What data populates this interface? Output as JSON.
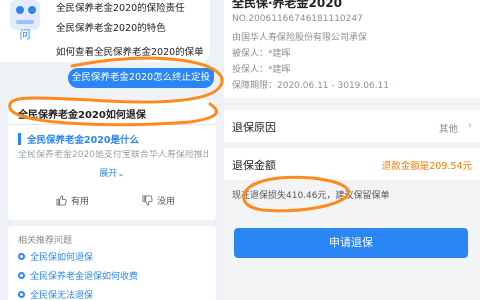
{
  "chat": {
    "bot_faqs": [
      "全民保养老金2020的保险责任",
      "全民保养老金2020的特色",
      "如何查看全民保养老金2020的保单"
    ],
    "user_message": "全民保养老金2020怎么终止定投",
    "answer": {
      "title": "全民保养老金2020如何退保",
      "subtitle": "全民保养老金2020是什么",
      "snippet": "全民保养老金2020是支付宝联合华人寿保险推出的",
      "expand_label": "展开",
      "useful_label": "有用",
      "useless_label": "没用"
    },
    "related": {
      "title": "相关推荐问题",
      "items": [
        "全民保如何退保",
        "全民保养老金退保如何收费",
        "全民保无法退保"
      ]
    }
  },
  "policy": {
    "name": "全民保·养老金2020",
    "number": "NO.20061166746181110247",
    "insurer": "由国华人寿保险股份有限公司承保",
    "insured": "被保人：*建晖",
    "applicant": "投保人：*建晖",
    "period": "保障期限：2020.06.11 - 3019.06.11"
  },
  "surrender": {
    "reason_label": "退保原因",
    "reason_value": "其他",
    "amount_label": "退保金额",
    "amount_value": "退款金额是209.54元",
    "loss_text": "现在退保损失410.46元，建议保留保单",
    "apply_label": "申请退保"
  },
  "colors": {
    "accent": "#2a86f5",
    "warning": "#f57c00",
    "annotation": "#ff8a1c"
  }
}
